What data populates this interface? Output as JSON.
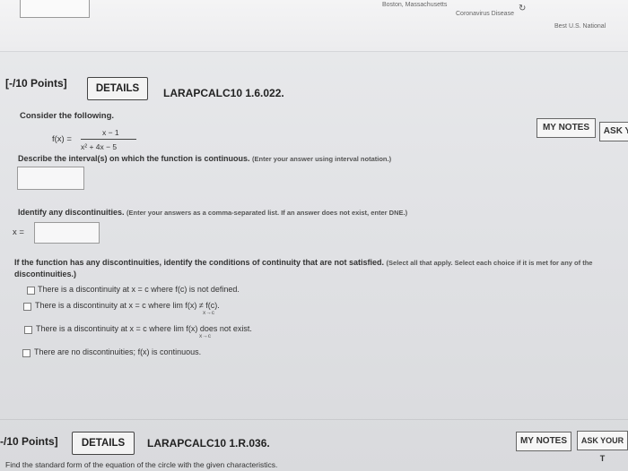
{
  "browser": {
    "tabs": [
      "Boston, Massachusetts",
      "Coronavirus Disease",
      "Best U.S. National"
    ],
    "reload_icon": "refresh-icon"
  },
  "question1": {
    "points": "[-/10 Points]",
    "details_label": "DETAILS",
    "code": "LARAPCALC10 1.6.022.",
    "my_notes_label": "MY NOTES",
    "ask_label": "ASK Y",
    "prompt": "Consider the following.",
    "function_lhs": "f(x) =",
    "numerator": "x − 1",
    "denominator": "x² + 4x − 5",
    "part1_text": "Describe the interval(s) on which the function is continuous.",
    "part1_hint": "(Enter your answer using interval notation.)",
    "part2_text": "Identify any discontinuities.",
    "part2_hint": "(Enter your answers as a comma-separated list. If an answer does not exist, enter DNE.)",
    "part2_label": "x =",
    "part3_text": "If the function has any discontinuities, identify the conditions of continuity that are not satisfied.",
    "part3_hint": "(Select all that apply. Select each choice if it is met for any of the",
    "part3_text2": "discontinuities.)",
    "options": [
      "There is a discontinuity at x = c where f(c) is not defined.",
      "There is a discontinuity at x = c where  lim  f(x) ≠ f(c).",
      "There is a discontinuity at x = c where  lim  f(x) does not exist.",
      "There are no discontinuities; f(x) is continuous."
    ],
    "limit_sub": "x→c"
  },
  "question2": {
    "points": "-/10 Points]",
    "details_label": "DETAILS",
    "code": "LARAPCALC10 1.R.036.",
    "my_notes_label": "MY NOTES",
    "ask_label": "ASK YOUR T",
    "prompt": "Find the standard form of the equation of the circle with the given characteristics."
  }
}
